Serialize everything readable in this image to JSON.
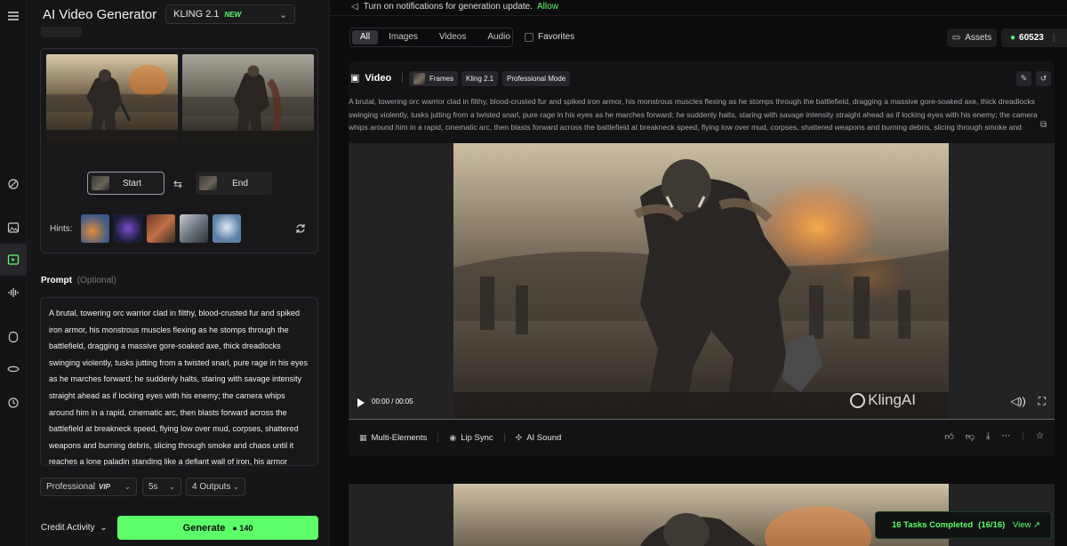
{
  "sidebar": {
    "icons": [
      "menu-icon",
      "effects-icon",
      "image-icon",
      "video-icon",
      "audio-icon",
      "model-icon",
      "eye-icon",
      "history-icon"
    ]
  },
  "generator": {
    "title": "AI Video Generator",
    "model": {
      "name": "KLING 2.1",
      "badge": "NEW"
    },
    "start_label": "Start",
    "end_label": "End",
    "hints_label": "Hints:",
    "prompt_title": "Prompt",
    "prompt_optional": "(Optional)",
    "prompt_text": "A brutal, towering orc warrior clad in filthy, blood-crusted fur and spiked iron armor, his monstrous muscles flexing as he stomps through the battlefield, dragging a massive gore-soaked axe, thick dreadlocks swinging violently, tusks jutting from a twisted snarl, pure rage in his eyes as he marches forward; he suddenly halts, staring with savage intensity straight ahead as if locking eyes with his enemy; the camera whips around him in a rapid, cinematic arc, then blasts forward across the battlefield at breakneck speed, flying low over mud, corpses, shattered weapons and burning debris, slicing through smoke and chaos until it reaches a lone paladin standing like a defiant wall of iron, his armor scarred and dented, cape torn and trailing,",
    "mode_select": {
      "value": "Professional",
      "badge": "VIP"
    },
    "duration_select": "5s",
    "outputs_select": "4 Outputs",
    "credit_activity": "Credit Activity",
    "generate_label": "Generate",
    "generate_cost": "140"
  },
  "main": {
    "notice": "Turn on notifications for generation update.",
    "notice_action": "Allow",
    "filters": [
      "All",
      "Images",
      "Videos",
      "Audio"
    ],
    "active_filter": "All",
    "favorites_label": "Favorites",
    "assets_label": "Assets",
    "credits": "60523",
    "video_card": {
      "title": "Video",
      "chips": [
        "Frames",
        "Kling 2.1",
        "Professional Mode"
      ],
      "description": "A brutal, towering orc warrior clad in filthy, blood-crusted fur and spiked iron armor, his monstrous muscles flexing as he stomps through the battlefield, dragging a massive gore-soaked axe, thick dreadlocks swinging violently, tusks jutting from a twisted snarl, pure rage in his eyes as he marches forward; he suddenly halts, staring with savage intensity straight ahead as if locking eyes with his enemy; the camera whips around him in a rapid, cinematic arc, then blasts forward across the battlefield at breakneck speed, flying low over mud, corpses, shattered weapons and burning debris, slicing through smoke and",
      "time": "00:00 / 00:05",
      "progress": 0,
      "watermark": "KlingAI",
      "tools": [
        "Multi-Elements",
        "Lip Sync",
        "AI Sound"
      ]
    },
    "toast": {
      "text": "16 Tasks Completed",
      "count": "(16/16)",
      "action": "View"
    }
  },
  "colors": {
    "accent": "#5cff6a",
    "bg": "#0c0c0e",
    "panel": "#161618"
  }
}
